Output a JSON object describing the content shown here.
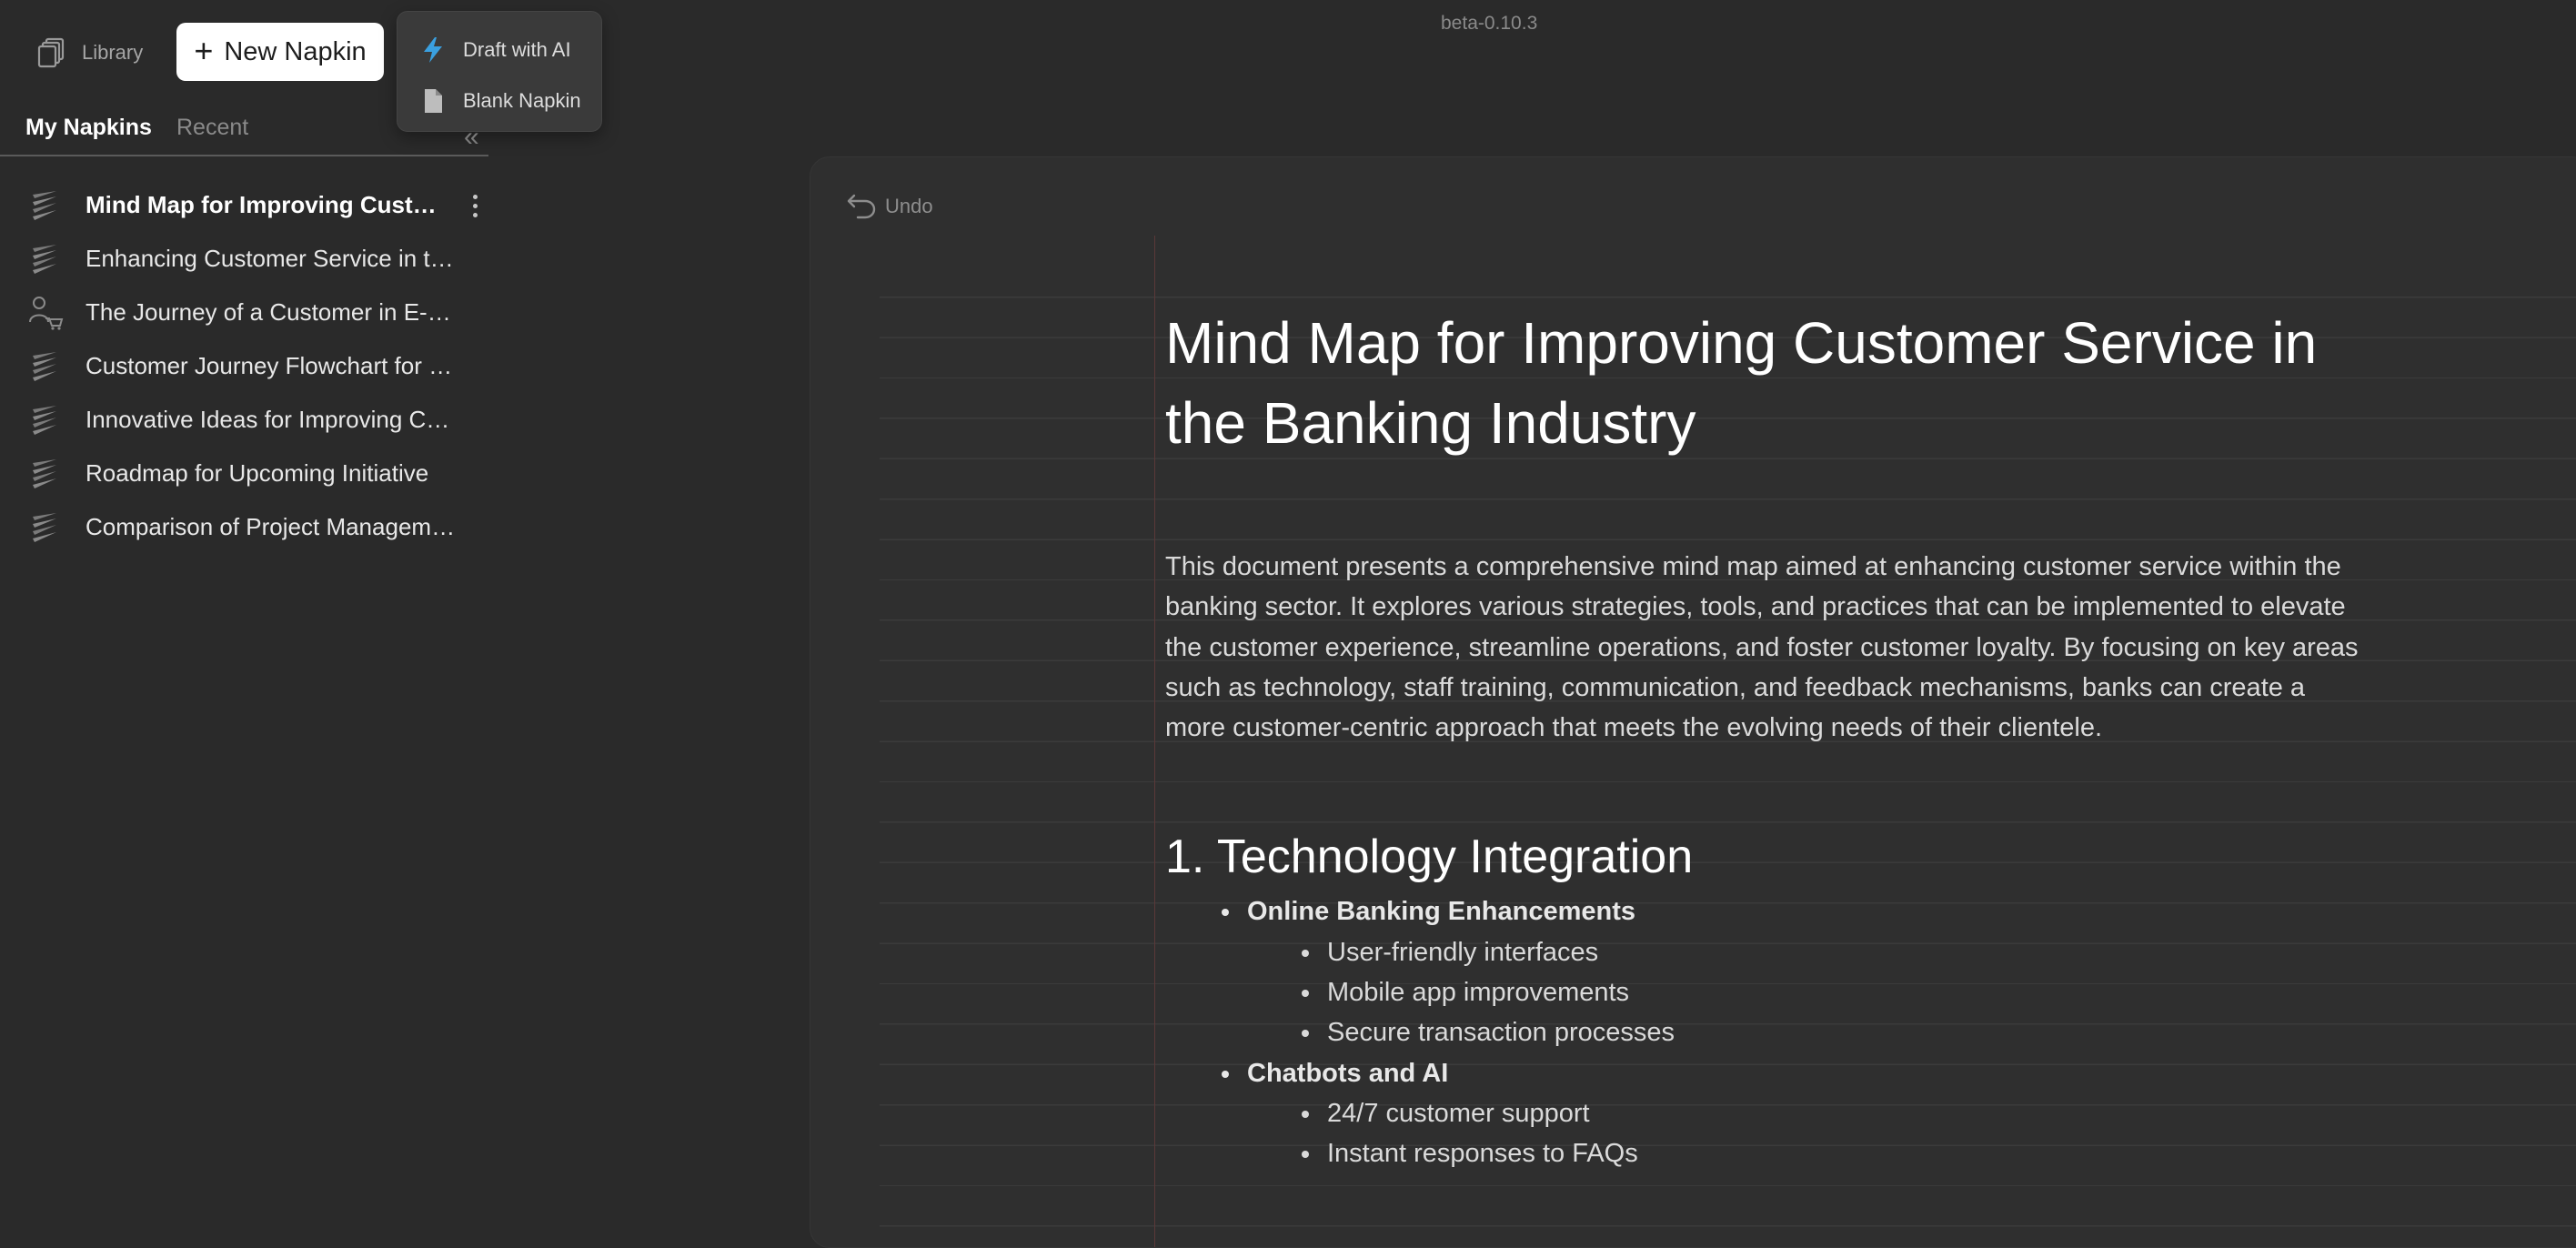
{
  "header": {
    "library_label": "Library",
    "new_napkin_label": "New Napkin",
    "version": "beta-0.10.3"
  },
  "new_menu": {
    "items": [
      {
        "label": "Draft with AI",
        "icon": "lightning-icon",
        "icon_color": "#3aa0e0"
      },
      {
        "label": "Blank Napkin",
        "icon": "document-icon"
      }
    ]
  },
  "sidebar": {
    "tabs": [
      {
        "label": "My Napkins",
        "active": true
      },
      {
        "label": "Recent",
        "active": false
      }
    ],
    "collapse_icon": "double-chevron-left-icon",
    "napkins": [
      {
        "title": "Mind Map for Improving Custom...",
        "icon": "stacked-layers-icon",
        "active": true
      },
      {
        "title": "Enhancing Customer Service in the...",
        "icon": "stacked-layers-icon"
      },
      {
        "title": "The Journey of a Customer in E-Co...",
        "icon": "person-cart-icon"
      },
      {
        "title": "Customer Journey Flowchart for N...",
        "icon": "stacked-layers-icon"
      },
      {
        "title": "Innovative Ideas for Improving Cus...",
        "icon": "stacked-layers-icon"
      },
      {
        "title": "Roadmap for Upcoming Initiative",
        "icon": "stacked-layers-icon"
      },
      {
        "title": "Comparison of Project Manageme...",
        "icon": "stacked-layers-icon"
      }
    ]
  },
  "document": {
    "undo_label": "Undo",
    "title": "Mind Map for Improving Customer Service in the Banking Industry",
    "intro": "This document presents a comprehensive mind map aimed at enhancing customer service within the banking sector. It explores various strategies, tools, and practices that can be implemented to elevate the customer experience, streamline operations, and foster customer loyalty. By focusing on key areas such as technology, staff training, communication, and feedback mechanisms, banks can create a more customer-centric approach that meets the evolving needs of their clientele.",
    "section1": {
      "heading": "1. Technology Integration",
      "groups": [
        {
          "label": "Online Banking Enhancements",
          "items": [
            "User-friendly interfaces",
            "Mobile app improvements",
            "Secure transaction processes"
          ]
        },
        {
          "label": "Chatbots and AI",
          "items": [
            "24/7 customer support",
            "Instant responses to FAQs"
          ]
        }
      ]
    }
  },
  "colors": {
    "background": "#2a2a2a",
    "panel": "#2f2f2f",
    "accent": "#3aa0e0",
    "margin_line": "#5a3838"
  }
}
